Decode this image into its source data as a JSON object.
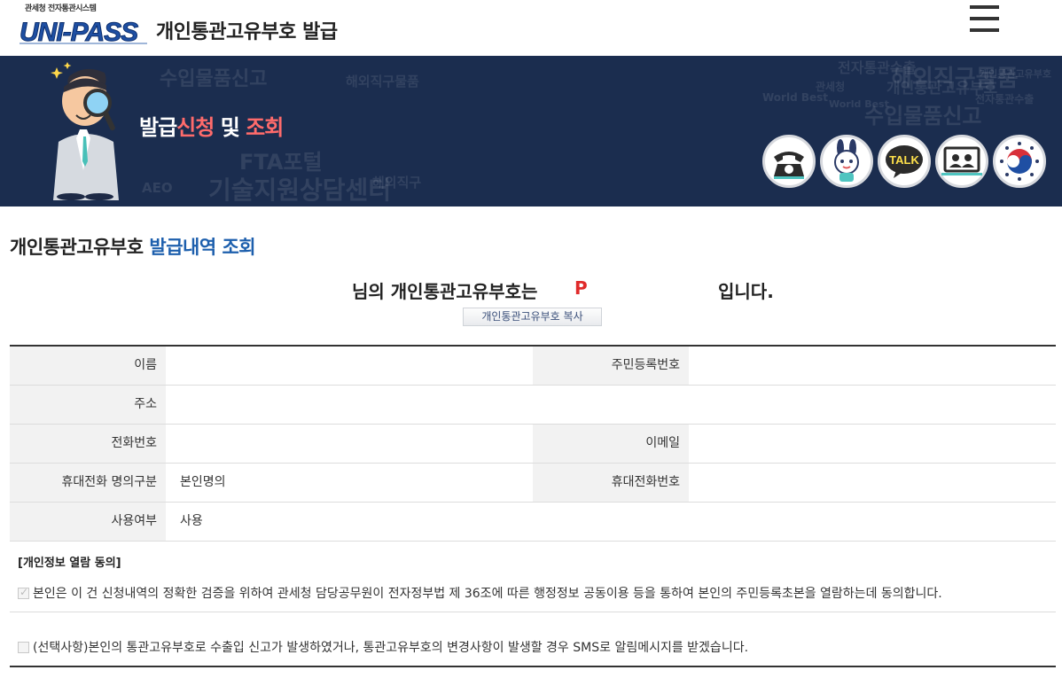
{
  "header": {
    "logo_small_text": "관세청 전자통관시스템",
    "logo_text": "UNI-PASS",
    "title": "개인통관고유부호 발급"
  },
  "banner": {
    "title_part1": "발급",
    "title_part2": "신청",
    "title_part3": " 및 ",
    "title_part4": "조회",
    "background_words": [
      "수입물품신고",
      "해외직구물품",
      "전자통관수출",
      "개인통관고유부호",
      "World Best",
      "FTA포털",
      "기술지원상담센터",
      "AEO",
      "해외직구",
      "관세청"
    ],
    "quick_icons": [
      "telephone-icon",
      "chatbot-icon",
      "kakao-talk-icon",
      "remote-support-icon",
      "government-emblem-icon"
    ],
    "talk_label": "TALK"
  },
  "section": {
    "title_black": "개인통관고유부호 ",
    "title_blue": "발급내역 조회"
  },
  "result": {
    "prefix": "님의 개인통관고유부호는",
    "code": "P",
    "suffix": "입니다.",
    "copy_button": "개인통관고유부호 복사"
  },
  "table": {
    "name_label": "이름",
    "name_value": "",
    "ssn_label": "주민등록번호",
    "ssn_value": "",
    "address_label": "주소",
    "address_value": "",
    "phone_label": "전화번호",
    "phone_value": "",
    "email_label": "이메일",
    "email_value": "",
    "mobile_owner_label": "휴대전화 명의구분",
    "mobile_owner_value": "본인명의",
    "mobile_label": "휴대전화번호",
    "mobile_value": "",
    "usage_label": "사용여부",
    "usage_value": "사용"
  },
  "consent": {
    "heading": "[개인정보 열람 동의]",
    "item1_text": "본인은 이 건 신청내역의 정확한 검증을 위하여 관세청 담당공무원이 전자정부법 제 36조에 따른 행정정보 공동이용 등을 통하여 본인의 주민등록초본을 열람하는데 동의합니다.",
    "item1_checked": true,
    "item2_text": "(선택사항)본인의 통관고유부호로 수출입 신고가 발생하였거나, 통관고유부호의 변경사항이 발생할 경우 SMS로 알림메시지를 받겠습니다.",
    "item2_checked": false
  },
  "colors": {
    "banner_bg": "#1b2d4f",
    "highlight_red": "#ff6b6b",
    "title_blue": "#1d5fad",
    "code_red": "#e02b2b"
  }
}
